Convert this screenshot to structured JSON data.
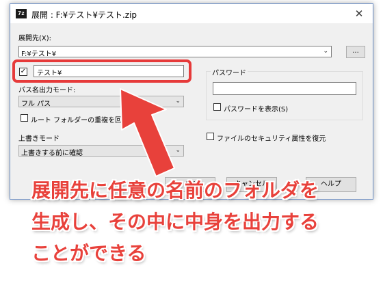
{
  "window": {
    "title": "展開 : F:¥テスト¥テスト.zip",
    "app_icon_text": "7z",
    "close_glyph": "✕"
  },
  "extract_to": {
    "label": "展開先(X):",
    "value": "F:¥テスト¥",
    "browse_label": "..."
  },
  "subfolder": {
    "checked": true,
    "check_glyph": "✓",
    "value": "テスト¥"
  },
  "path_mode": {
    "label": "パス名出力モード:",
    "value": "フル パス"
  },
  "eliminate_dup": {
    "label": "ルート フォルダーの重複を回避",
    "checked": false
  },
  "overwrite": {
    "label": "上書きモード",
    "value": "上書きする前に確認"
  },
  "password": {
    "group_label": "パスワード",
    "value": "",
    "show_label": "パスワードを表示(S)",
    "show_checked": false
  },
  "security": {
    "label": "ファイルのセキュリティ属性を復元",
    "checked": false
  },
  "buttons": {
    "ok": "OK",
    "cancel": "キャンセル",
    "help": "ヘルプ"
  },
  "annotation": {
    "line1": "展開先に任意の名前のフォルダを",
    "line2": "生成し、その中に中身を出力する",
    "line3": "ことができる",
    "color": "#e8413b"
  }
}
